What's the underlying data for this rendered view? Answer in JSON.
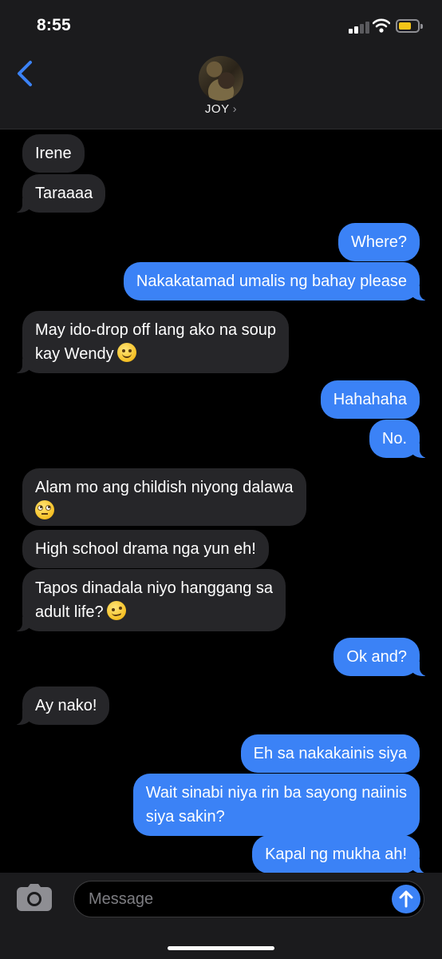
{
  "status_bar": {
    "time": "8:55"
  },
  "header": {
    "contact_name": "JOY",
    "chevron": "›"
  },
  "messages": [
    {
      "dir": "in",
      "text": "Irene"
    },
    {
      "dir": "in",
      "text": "Taraaaa"
    },
    {
      "dir": "out",
      "text": "Where?"
    },
    {
      "dir": "out",
      "text": "Nakakatamad umalis ng bahay please"
    },
    {
      "dir": "in",
      "line1": "May ido-drop off lang ako na soup",
      "line2": "kay Wendy",
      "emoji": "smiling-face-icon"
    },
    {
      "dir": "out",
      "text": "Hahahaha"
    },
    {
      "dir": "out",
      "text": "No."
    },
    {
      "dir": "in",
      "line1": "Alam mo ang childish niyong dalawa",
      "emoji": "eye-roll-face-icon"
    },
    {
      "dir": "in",
      "text": "High school drama nga yun eh!"
    },
    {
      "dir": "in",
      "line1": "Tapos dinadala niyo hanggang sa",
      "line2": "adult life?",
      "emoji": "woozy-face-icon"
    },
    {
      "dir": "out",
      "text": "Ok and?"
    },
    {
      "dir": "in",
      "text": "Ay nako!"
    },
    {
      "dir": "out",
      "text": "Eh sa nakakainis siya"
    },
    {
      "dir": "out",
      "line1": "Wait sinabi niya rin ba sayong naiinis",
      "line2": "siya sakin?"
    },
    {
      "dir": "out",
      "text": "Kapal ng mukha ah!"
    }
  ],
  "compose": {
    "placeholder": "Message"
  },
  "colors": {
    "incoming": "#262629",
    "outgoing": "#3b82f6",
    "header": "#1b1b1d"
  },
  "icons": [
    "back-chevron-icon",
    "camera-icon",
    "send-arrow-icon",
    "wifi-icon",
    "battery-icon",
    "signal-icon"
  ]
}
